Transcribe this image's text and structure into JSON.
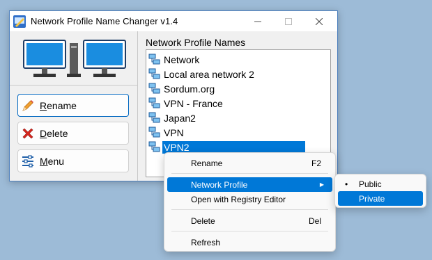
{
  "window": {
    "title": "Network Profile Name Changer v1.4",
    "controls": {
      "minimize": "—",
      "maximize": "☐",
      "close": "✕"
    }
  },
  "left_panel": {
    "buttons": [
      {
        "label": "Rename",
        "mnemonic": "R",
        "rest": "ename",
        "icon": "pencil-icon"
      },
      {
        "label": "Delete",
        "mnemonic": "D",
        "rest": "elete",
        "icon": "red-x-icon"
      },
      {
        "label": "Menu",
        "mnemonic": "M",
        "rest": "enu",
        "icon": "sliders-icon"
      }
    ]
  },
  "list": {
    "label": "Network Profile Names",
    "items": [
      "Network",
      "Local area network 2",
      "Sordum.org",
      "VPN - France",
      "Japan2",
      "VPN",
      "VPN2"
    ],
    "selected": "VPN2"
  },
  "context_menu": {
    "items": [
      {
        "label": "Rename",
        "shortcut": "F2"
      },
      {
        "label": "Network Profile",
        "submenu": true,
        "highlighted": true
      },
      {
        "label": "Open with Registry Editor"
      },
      {
        "label": "Delete",
        "shortcut": "Del"
      },
      {
        "label": "Refresh"
      }
    ]
  },
  "submenu": {
    "items": [
      {
        "label": "Public",
        "checked": true
      },
      {
        "label": "Private",
        "highlighted": true
      }
    ]
  },
  "colors": {
    "accent": "#0078d7",
    "desktop": "#9dbbd7",
    "window_border": "#4c7fbd"
  }
}
